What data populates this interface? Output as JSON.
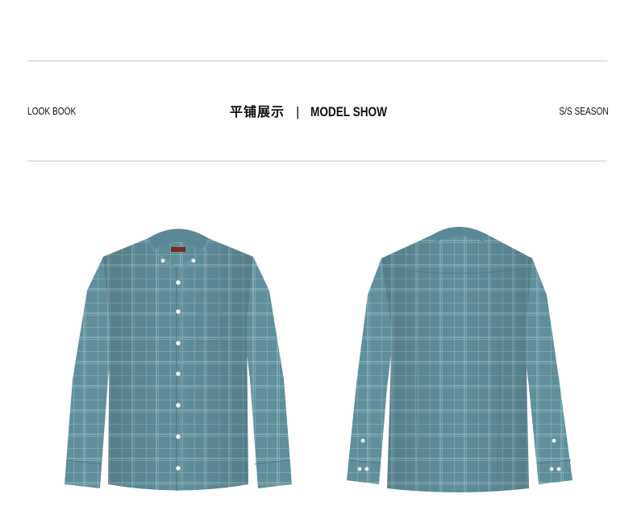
{
  "header": {
    "left_label": "LOOK BOOK",
    "center_cn": "平铺展示",
    "center_sep": "|",
    "center_en": "MODEL SHOW",
    "right_label": "S/S SEASON"
  },
  "products": [
    {
      "view": "front",
      "color": "#5f8f9b"
    },
    {
      "view": "back",
      "color": "#5f8f9b"
    }
  ],
  "colors": {
    "divider": "#c8c8c8",
    "text": "#111111",
    "shirt_base": "#5f8f9b",
    "shirt_shadow": "#4d7a86",
    "check_lines": "#9ec2c8"
  }
}
